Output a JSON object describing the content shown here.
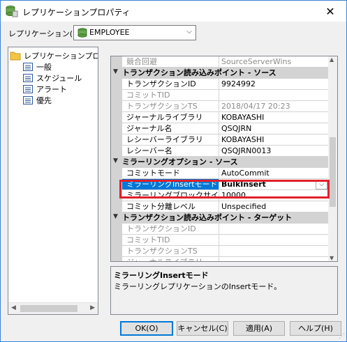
{
  "window": {
    "title": "レプリケーションプロパティ",
    "close": "✕"
  },
  "replication": {
    "label": "レプリケーション(R)",
    "value": "EMPLOYEE",
    "dropdown": "⌵"
  },
  "tree": [
    {
      "label": "レプリケーションプロパティ",
      "icon": "folder-icon"
    },
    {
      "label": "一般",
      "icon": "list-page-icon"
    },
    {
      "label": "スケジュール",
      "icon": "list-page-icon"
    },
    {
      "label": "アラート",
      "icon": "list-page-icon"
    },
    {
      "label": "優先",
      "icon": "list-page-icon"
    }
  ],
  "grid": {
    "rows": [
      {
        "kind": "prop",
        "name": "競合回避",
        "value": "SourceServerWins",
        "disabled": true
      },
      {
        "kind": "category",
        "label": "トランザクション読み込みポイント - ソース"
      },
      {
        "kind": "prop",
        "name": "トランザクションID",
        "value": "9924992"
      },
      {
        "kind": "prop",
        "name": "コミットTID",
        "value": "",
        "disabled": true
      },
      {
        "kind": "prop",
        "name": "トランザクションTS",
        "value": "2018/04/17 20:23",
        "disabled": true
      },
      {
        "kind": "prop",
        "name": "ジャーナルライブラリ",
        "value": "KOBAYASHI"
      },
      {
        "kind": "prop",
        "name": "ジャーナル名",
        "value": "QSQJRN"
      },
      {
        "kind": "prop",
        "name": "レシーバーライブラリ",
        "value": "KOBAYASHI"
      },
      {
        "kind": "prop",
        "name": "レシーバー名",
        "value": "QSQJRN0013"
      },
      {
        "kind": "category",
        "label": "ミラーリングオプション - ソース"
      },
      {
        "kind": "prop",
        "name": "コミットモード",
        "value": "AutoCommit"
      },
      {
        "kind": "prop",
        "name": "ミラーリングInsertモード",
        "value": "BulkInsert",
        "selected": true
      },
      {
        "kind": "prop",
        "name": "ミラーリングブロックサイズ",
        "value": "10000"
      },
      {
        "kind": "prop",
        "name": "コミット分離レベル",
        "value": "Unspecified"
      },
      {
        "kind": "category",
        "label": "トランザクション読み込みポイント - ターゲット"
      },
      {
        "kind": "prop",
        "name": "トランザクションID",
        "value": "",
        "disabled": true
      },
      {
        "kind": "prop",
        "name": "コミットTID",
        "value": "",
        "disabled": true
      },
      {
        "kind": "prop",
        "name": "トランザクションTS",
        "value": "",
        "disabled": true
      },
      {
        "kind": "prop",
        "name": "ジャーナルライブラリ",
        "value": "",
        "disabled": true
      }
    ]
  },
  "description": {
    "title": "ミラーリングInsertモード",
    "text": "ミラーリングレプリケーションのInsertモード。"
  },
  "buttons": {
    "ok": "OK(O)",
    "cancel": "キャンセル(C)",
    "apply": "適用(A)",
    "help": "ヘルプ(H)"
  },
  "colors": {
    "selection": "#0078d7",
    "highlight_frame": "#e0202a",
    "category_bg": "#d3d3d3"
  }
}
